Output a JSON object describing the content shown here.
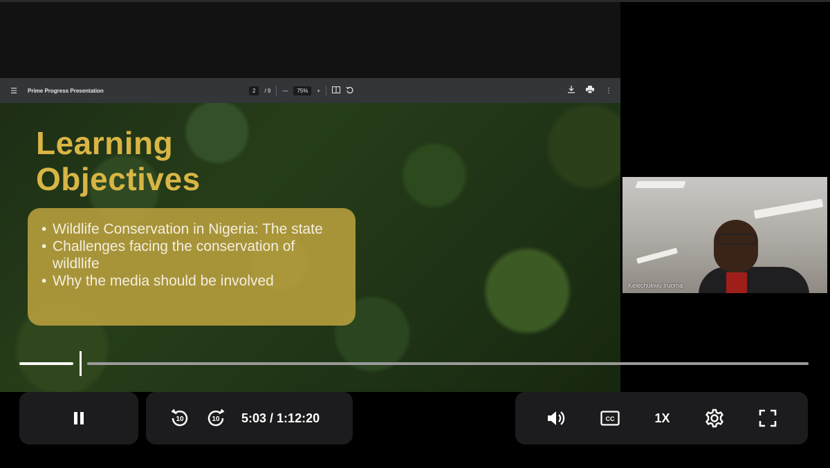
{
  "pdf_viewer": {
    "title": "Prime Progress Presentation",
    "page_current": "2",
    "page_total": "/ 9",
    "zoom": "75%",
    "zoom_out_label": "—",
    "zoom_in_label": "+",
    "menu_icon": "hamburger-icon",
    "download_icon": "download-icon",
    "print_icon": "print-icon",
    "more_icon": "more-vertical-icon"
  },
  "slide": {
    "title_line1": "Learning",
    "title_line2": "Objectives",
    "bullets": [
      "Wildlife Conservation in Nigeria: The state",
      "Challenges facing the conservation of wildllife",
      "Why the media should be involved"
    ],
    "title_color": "#d8b545",
    "box_color": "#b9a03e"
  },
  "participant": {
    "name": "Kelechukwu Iruoma"
  },
  "player": {
    "current_time": "5:03",
    "separator": " / ",
    "duration": "1:12:20",
    "progress_fraction": 0.07,
    "speed_label": "1X",
    "rewind_label": "10",
    "forward_label": "10",
    "icons": {
      "pause": "pause-icon",
      "rewind": "rewind-10-icon",
      "forward": "forward-10-icon",
      "volume": "volume-icon",
      "captions": "closed-captions-icon",
      "settings": "gear-icon",
      "fullscreen": "fullscreen-icon"
    }
  }
}
